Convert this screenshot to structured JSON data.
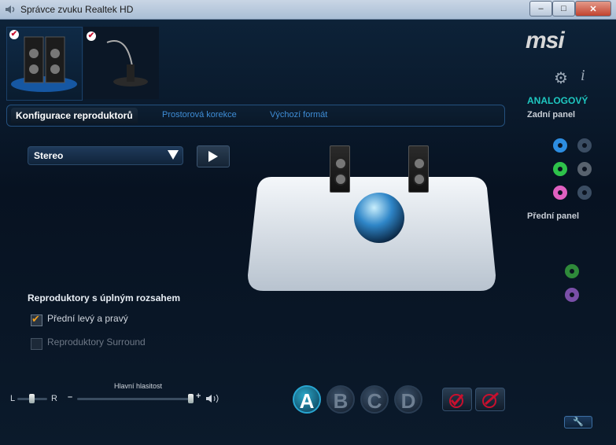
{
  "window": {
    "title": "Správce zvuku Realtek HD",
    "minimize": "–",
    "maximize": "□",
    "close": "✕"
  },
  "devices": [
    {
      "name": "speakers-device",
      "checked": true,
      "selected": true
    },
    {
      "name": "microphone-device",
      "checked": true,
      "selected": false
    }
  ],
  "brand": {
    "logo": "msi"
  },
  "right": {
    "analog_label": "ANALOGOVÝ",
    "rear_panel": "Zadní panel",
    "front_panel": "Přední panel",
    "settings_icon": "gear-icon",
    "info_icon": "info-icon",
    "jack_colors": {
      "blue": "#2d8de0",
      "green": "#2ec24a",
      "pink": "#e060c0",
      "front_green": "#2f8a3a",
      "front_purple": "#7a4fa8",
      "grey": "#3b4d63"
    }
  },
  "tabs": [
    {
      "label": "Konfigurace reproduktorů",
      "active": true
    },
    {
      "label": "Prostorová korekce",
      "active": false
    },
    {
      "label": "Výchozí formát",
      "active": false
    }
  ],
  "config": {
    "selected": "Stereo"
  },
  "fullrange": {
    "title": "Reproduktory s úplným rozsahem",
    "options": [
      {
        "label": "Přední levý a pravý",
        "checked": true,
        "enabled": true
      },
      {
        "label": "Reproduktory Surround",
        "checked": false,
        "enabled": false
      }
    ]
  },
  "volume": {
    "title": "Hlavní hlasitost",
    "left": "L",
    "right": "R",
    "minus": "–",
    "plus": "+",
    "balance": 0.5,
    "level": 1.0
  },
  "profiles": [
    "A",
    "B",
    "C",
    "D"
  ],
  "active_profile": "A"
}
